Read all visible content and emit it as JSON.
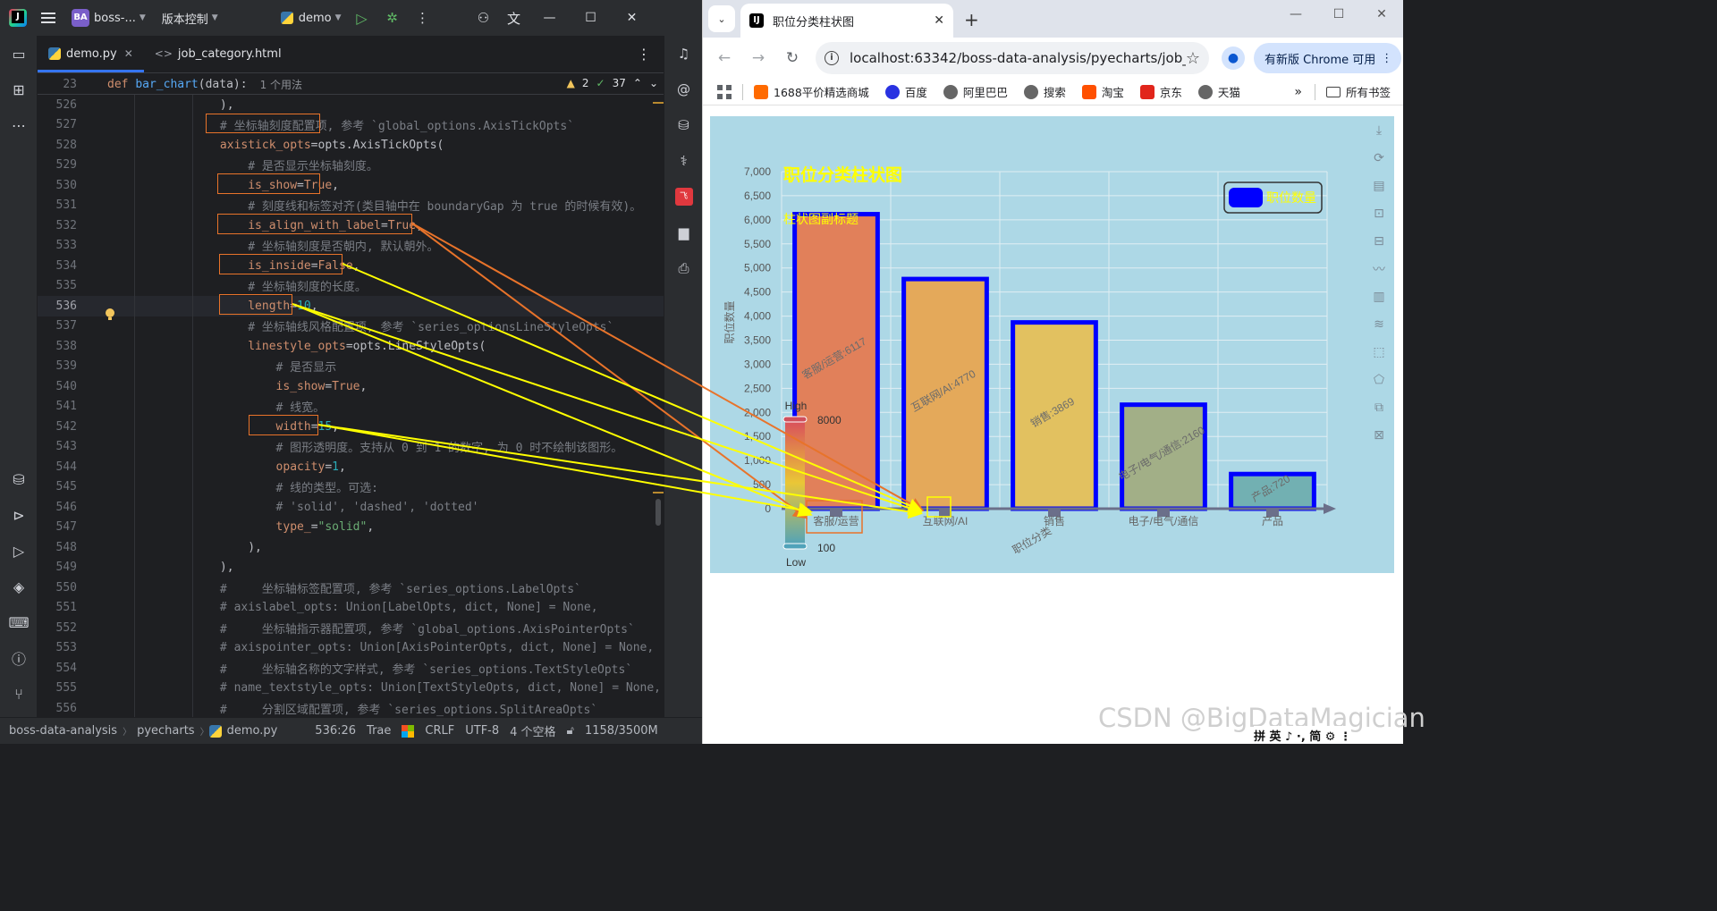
{
  "ide": {
    "project_badge": "BA",
    "project_name": "boss-...",
    "vcs_label": "版本控制",
    "run_config": "demo",
    "tabs": [
      {
        "label": "demo.py",
        "active": true
      },
      {
        "label": "job_category.html",
        "active": false
      }
    ],
    "sticky": {
      "line_no": "23",
      "code_def": "def",
      "code_name": "bar_chart",
      "code_rest": "(data):",
      "usage_hint": "1 个用法"
    },
    "inspections": {
      "warnings": "2",
      "weak_warnings": "37"
    },
    "lines": [
      {
        "no": "526",
        "segs": [
          {
            "t": "            ),",
            "c": "plain"
          }
        ]
      },
      {
        "no": "527",
        "segs": [
          {
            "t": "            # ",
            "c": "comment"
          },
          {
            "t": "坐标轴刻度配置项,",
            "c": "comment"
          },
          {
            "t": " 参考 `global_options.AxisTickOpts`",
            "c": "comment"
          }
        ]
      },
      {
        "no": "528",
        "segs": [
          {
            "t": "            ",
            "c": "plain"
          },
          {
            "t": "axistick_opts",
            "c": "param"
          },
          {
            "t": "=opts.AxisTickOpts(",
            "c": "plain"
          }
        ]
      },
      {
        "no": "529",
        "segs": [
          {
            "t": "                # 是否显示坐标轴刻度。",
            "c": "comment"
          }
        ]
      },
      {
        "no": "530",
        "segs": [
          {
            "t": "                ",
            "c": "plain"
          },
          {
            "t": "is_show",
            "c": "param"
          },
          {
            "t": "=",
            "c": "plain"
          },
          {
            "t": "True",
            "c": "kw"
          },
          {
            "t": ",",
            "c": "plain"
          }
        ]
      },
      {
        "no": "531",
        "segs": [
          {
            "t": "                # 刻度线和标签对齐(类目轴中在 boundaryGap 为 true 的时候有效)。",
            "c": "comment"
          }
        ]
      },
      {
        "no": "532",
        "segs": [
          {
            "t": "                ",
            "c": "plain"
          },
          {
            "t": "is_align_with_label",
            "c": "param"
          },
          {
            "t": "=",
            "c": "plain"
          },
          {
            "t": "True",
            "c": "kw"
          },
          {
            "t": ",",
            "c": "plain"
          }
        ]
      },
      {
        "no": "533",
        "segs": [
          {
            "t": "                # 坐标轴刻度是否朝内, 默认朝外。",
            "c": "comment"
          }
        ]
      },
      {
        "no": "534",
        "segs": [
          {
            "t": "                ",
            "c": "plain"
          },
          {
            "t": "is_inside",
            "c": "param"
          },
          {
            "t": "=",
            "c": "plain"
          },
          {
            "t": "False",
            "c": "kw"
          },
          {
            "t": ",",
            "c": "plain"
          }
        ]
      },
      {
        "no": "535",
        "segs": [
          {
            "t": "                # 坐标轴刻度的长度。",
            "c": "comment"
          }
        ]
      },
      {
        "no": "536",
        "segs": [
          {
            "t": "                ",
            "c": "plain"
          },
          {
            "t": "length",
            "c": "param"
          },
          {
            "t": "=",
            "c": "plain"
          },
          {
            "t": "10",
            "c": "num"
          },
          {
            "t": ",",
            "c": "plain"
          }
        ]
      },
      {
        "no": "537",
        "segs": [
          {
            "t": "                # 坐标轴线风格配置项, 参考 `series_optionsLineStyleOpts`",
            "c": "comment"
          }
        ]
      },
      {
        "no": "538",
        "segs": [
          {
            "t": "                ",
            "c": "plain"
          },
          {
            "t": "linestyle_opts",
            "c": "param"
          },
          {
            "t": "=opts.LineStyleOpts(",
            "c": "plain"
          }
        ]
      },
      {
        "no": "539",
        "segs": [
          {
            "t": "                    # 是否显示",
            "c": "comment"
          }
        ]
      },
      {
        "no": "540",
        "segs": [
          {
            "t": "                    ",
            "c": "plain"
          },
          {
            "t": "is_show",
            "c": "param"
          },
          {
            "t": "=",
            "c": "plain"
          },
          {
            "t": "True",
            "c": "kw"
          },
          {
            "t": ",",
            "c": "plain"
          }
        ]
      },
      {
        "no": "541",
        "segs": [
          {
            "t": "                    # 线宽。",
            "c": "comment"
          }
        ]
      },
      {
        "no": "542",
        "segs": [
          {
            "t": "                    ",
            "c": "plain"
          },
          {
            "t": "width",
            "c": "param"
          },
          {
            "t": "=",
            "c": "plain"
          },
          {
            "t": "15",
            "c": "num"
          },
          {
            "t": ",",
            "c": "plain"
          }
        ]
      },
      {
        "no": "543",
        "segs": [
          {
            "t": "                    # 图形透明度。支持从 0 到 1 的数字, 为 0 时不绘制该图形。",
            "c": "comment"
          }
        ]
      },
      {
        "no": "544",
        "segs": [
          {
            "t": "                    ",
            "c": "plain"
          },
          {
            "t": "opacity",
            "c": "param"
          },
          {
            "t": "=",
            "c": "plain"
          },
          {
            "t": "1",
            "c": "num"
          },
          {
            "t": ",",
            "c": "plain"
          }
        ]
      },
      {
        "no": "545",
        "segs": [
          {
            "t": "                    # 线的类型。可选:",
            "c": "comment"
          }
        ]
      },
      {
        "no": "546",
        "segs": [
          {
            "t": "                    # 'solid', 'dashed', 'dotted'",
            "c": "comment"
          }
        ]
      },
      {
        "no": "547",
        "segs": [
          {
            "t": "                    ",
            "c": "plain"
          },
          {
            "t": "type_",
            "c": "param"
          },
          {
            "t": "=",
            "c": "plain"
          },
          {
            "t": "\"solid\"",
            "c": "str"
          },
          {
            "t": ",",
            "c": "plain"
          }
        ]
      },
      {
        "no": "548",
        "segs": [
          {
            "t": "                ),",
            "c": "plain"
          }
        ]
      },
      {
        "no": "549",
        "segs": [
          {
            "t": "            ),",
            "c": "plain"
          }
        ]
      },
      {
        "no": "550",
        "segs": [
          {
            "t": "            #     坐标轴标签配置项, 参考 `series_options.LabelOpts`",
            "c": "comment"
          }
        ]
      },
      {
        "no": "551",
        "segs": [
          {
            "t": "            # axislabel_opts: Union[LabelOpts, dict, None] = None,",
            "c": "comment"
          }
        ]
      },
      {
        "no": "552",
        "segs": [
          {
            "t": "            #     坐标轴指示器配置项, 参考 `global_options.AxisPointerOpts`",
            "c": "comment"
          }
        ]
      },
      {
        "no": "553",
        "segs": [
          {
            "t": "            # axispointer_opts: Union[AxisPointerOpts, dict, None] = None,",
            "c": "comment"
          }
        ]
      },
      {
        "no": "554",
        "segs": [
          {
            "t": "            #     坐标轴名称的文字样式, 参考 `series_options.TextStyleOpts`",
            "c": "comment"
          }
        ]
      },
      {
        "no": "555",
        "segs": [
          {
            "t": "            # name_textstyle_opts: Union[TextStyleOpts, dict, None] = None,",
            "c": "comment"
          }
        ]
      },
      {
        "no": "556",
        "segs": [
          {
            "t": "            #     分割区域配置项, 参考 `series_options.SplitAreaOpts`",
            "c": "comment"
          }
        ]
      }
    ],
    "status": {
      "project": "boss-data-analysis",
      "folder": "pyecharts",
      "file": "demo.py",
      "position": "536:26",
      "plugin": "Trae",
      "line_sep": "CRLF",
      "encoding": "UTF-8",
      "indent": "4 个空格",
      "memory": "1158/3500M"
    }
  },
  "browser": {
    "tab_title": "职位分类柱状图",
    "url": "localhost:63342/boss-data-analysis/pyecharts/job_...",
    "update_label": "有新版 Chrome 可用",
    "bookmarks": [
      "1688平价精选商城",
      "百度",
      "阿里巴巴",
      "搜索",
      "淘宝",
      "京东",
      "天猫"
    ],
    "all_bookmarks": "所有书签",
    "colors": {
      "chart_bg": "#add8e6",
      "bar_border": "#0000ff",
      "title": "#ffff00"
    }
  },
  "chart_data": {
    "type": "bar",
    "title": "职位分类柱状图",
    "subtitle": "柱状图副标题",
    "xlabel": "职位分类",
    "ylabel": "职位数量",
    "categories": [
      "客服/运营",
      "互联网/AI",
      "销售",
      "电子/电气/通信",
      "产品"
    ],
    "series": [
      {
        "name": "职位数量",
        "values": [
          6117,
          4770,
          3869,
          2160,
          720
        ]
      }
    ],
    "data_labels": [
      "客服/运营:6117",
      "互联网/AI:4770",
      "销售:3869",
      "电子/电气/通信:2160",
      "产品:720"
    ],
    "ylim": [
      0,
      7000
    ],
    "yticks": [
      "0",
      "500",
      "1,000",
      "1,500",
      "2,000",
      "2,500",
      "3,000",
      "3,500",
      "4,000",
      "4,500",
      "5,000",
      "5,500",
      "6,000",
      "6,500",
      "7,000"
    ],
    "visual_map": {
      "min": 100,
      "max": 8000,
      "high_text": "High",
      "low_text": "Low",
      "min_label": "100",
      "max_label": "8000"
    },
    "legend_position": "top-right",
    "grid": true
  },
  "watermark": "CSDN @BigDataMagician",
  "ime": "拼 英 ♪ ·, 简 ⚙ ⋮"
}
